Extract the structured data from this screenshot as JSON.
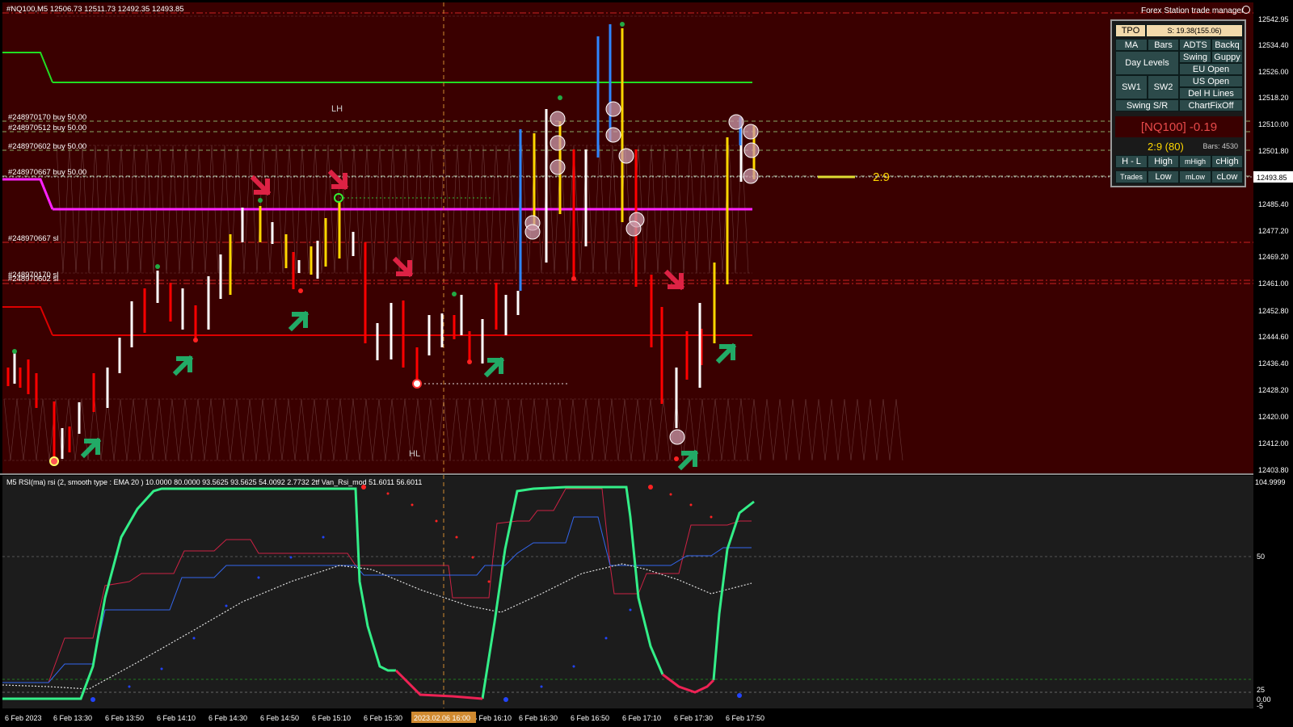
{
  "window": {
    "title": "Forex Station trade manager",
    "ohlc": "#NQ100,M5  12506.73 12511.73 12492.35 12493.85"
  },
  "colors": {
    "chart_bg": "#3a0000",
    "indicator_bg": "#1c1c1c",
    "up_bar": "#ffd700",
    "down_bar": "#ff0000",
    "neutral_bar": "#ffffff",
    "blue_bar": "#2f86ff",
    "magenta_line": "#ff22ff",
    "green_line": "#22dd22",
    "red_line": "#dd0000",
    "rsi_main": "#33ee88",
    "price_marker_bg": "#ffffff"
  },
  "price_axis": {
    "ticks": [
      "12542.95",
      "12534.40",
      "12526.00",
      "12518.20",
      "12510.00",
      "12501.80",
      "12485.40",
      "12477.20",
      "12469.20",
      "12461.00",
      "12452.80",
      "12444.60",
      "12436.40",
      "12428.20",
      "12420.00",
      "12412.00",
      "12403.80"
    ],
    "current_price": "12493.85"
  },
  "trade_labels": [
    "#248970170 buy 50.00",
    "#248970512 buy 50.00",
    "#248970602 buy 50.00",
    "#248970667 buy 50.00",
    "#248970667 sl",
    "#248970170 sl",
    "#248970602 sl"
  ],
  "chart_labels": {
    "lh": "LH",
    "hl": "HL",
    "rr": "2:9"
  },
  "indicator": {
    "title": "M5 RSI(ma) rsi (2, smooth type : EMA  20 ) 10.0000 80.0000 93.5625 93.5625 54.0092 2.7732  2tf  Van_Rsi_mod 51.6011 56.6011",
    "axis_ticks": [
      "104.9999",
      "50",
      "25",
      "0.00",
      "-5"
    ]
  },
  "time_axis": {
    "labels": [
      "6 Feb 2023",
      "6 Feb 13:30",
      "6 Feb 13:50",
      "6 Feb 14:10",
      "6 Feb 14:30",
      "6 Feb 14:50",
      "6 Feb 15:10",
      "6 Feb 15:30",
      "6 Feb 16:10",
      "6 Feb 16:30",
      "6 Feb 16:50",
      "6 Feb 17:10",
      "6 Feb 17:30",
      "6 Feb 17:50"
    ],
    "crosshair_label": "2023.02.06 16:00"
  },
  "panel": {
    "tpo": "TPO",
    "spread": "S: 19.38(155.06)",
    "buttons": {
      "ma": "MA",
      "bars": "Bars",
      "adts": "ADTS",
      "backq": "Backq",
      "day_levels": "Day Levels",
      "swing": "Swing",
      "guppy": "Guppy",
      "eu_open": "EU Open",
      "us_open": "US Open",
      "sw1": "SW1",
      "sw2": "SW2",
      "del_h_lines": "Del H Lines",
      "swing_sr": "Swing S/R",
      "chartfixoff": "ChartFixOff",
      "hl": "H - L",
      "high": "High",
      "mhigh": "mHigh",
      "chigh": "cHigh",
      "trades": "Trades",
      "low": "Low",
      "mlow": "mLow",
      "clow": "cLow"
    },
    "symbol": "[NQ100] -0.19",
    "rr": "2:9 (80)",
    "bars": "Bars: 4530"
  }
}
